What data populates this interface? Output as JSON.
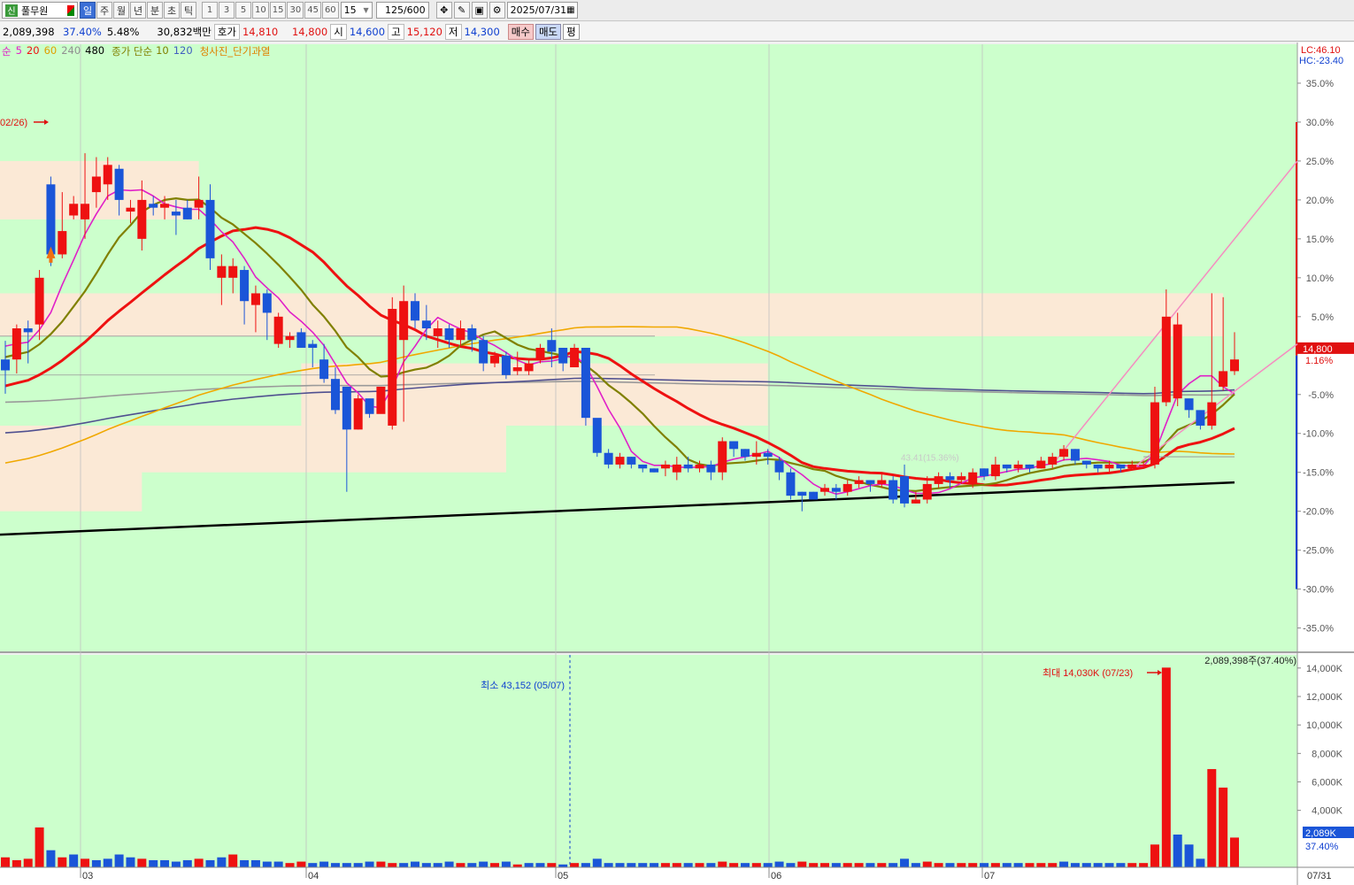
{
  "toolbar": {
    "logo": "신",
    "stock_name": "풀무원",
    "periods": [
      "일",
      "주",
      "월",
      "년",
      "분",
      "초",
      "틱"
    ],
    "selected_period": "일",
    "intervals": [
      "1",
      "3",
      "5",
      "10",
      "15",
      "30",
      "45",
      "60"
    ],
    "interval_select": "15",
    "count": "125",
    "count_total": "/600",
    "date": "2025/07/31"
  },
  "quote": {
    "volume": "2,089,398",
    "volume_ratio": "37.40%",
    "turnover": "5.48%",
    "amount": "30,832백만",
    "ask_label": "호가",
    "ask1": "14,810",
    "ask2": "14,800",
    "open_label": "시",
    "open": "14,600",
    "high_label": "고",
    "high": "15,120",
    "low_label": "저",
    "low": "14,300",
    "buy_label": "매수",
    "sell_label": "매도",
    "avg_label": "평"
  },
  "legend": {
    "ma_label": "순",
    "ma_periods": [
      "5",
      "20",
      "60",
      "240",
      "480"
    ],
    "vol_ma_label": "종가 단순",
    "vol_ma_periods": [
      "10",
      "120"
    ],
    "signal_label": "청사진_단기과열"
  },
  "colors": {
    "background": "#ccffcc",
    "up": "#ee1111",
    "down": "#1a55d8",
    "ma5": "#e020c8",
    "ma20": "#808000",
    "ma60": "#ee1111",
    "ma240": "#f0a800",
    "ma480": "#505090",
    "zone": "#fbe9d6"
  },
  "chart_data": [
    {
      "type": "candlestick",
      "title": "",
      "x_ticks": [
        "03",
        "04",
        "05",
        "06",
        "07",
        "07/31"
      ],
      "y_axis_right": [
        "35.0%",
        "30.0%",
        "25.0%",
        "20.0%",
        "15.0%",
        "10.0%",
        "5.0%",
        "-5.0%",
        "-10.0%",
        "-15.0%",
        "-20.0%",
        "-25.0%",
        "-30.0%",
        "-35.0%"
      ],
      "ylim": [
        -38,
        40
      ],
      "reference_labels": {
        "lc": "LC:46.10",
        "hc": "HC:-23.40"
      },
      "current_price_label": "14,800",
      "current_change_label": "1.16%",
      "annotations": [
        "02/26)",
        "43.41(15.36%)"
      ],
      "candles": [
        [
          -0.5,
          -1.9,
          1.9,
          -4.9
        ],
        [
          -0.5,
          3.5,
          4.0,
          -2.3
        ],
        [
          3.5,
          3.0,
          4.5,
          -1.0
        ],
        [
          4.0,
          10.0,
          11.0,
          2.0
        ],
        [
          22.0,
          13.0,
          23.0,
          11.5
        ],
        [
          13.0,
          16.0,
          21.0,
          12.5
        ],
        [
          18.0,
          19.5,
          20.5,
          17.5
        ],
        [
          17.5,
          19.5,
          26.0,
          15.0
        ],
        [
          21.0,
          23.0,
          25.5,
          19.0
        ],
        [
          22.0,
          24.5,
          25.5,
          20.0
        ],
        [
          24.0,
          20.0,
          24.5,
          18.0
        ],
        [
          18.5,
          19.0,
          20.0,
          17.0
        ],
        [
          15.0,
          20.0,
          22.5,
          13.5
        ],
        [
          19.5,
          19.0,
          20.5,
          18.0
        ],
        [
          19.0,
          19.5,
          20.5,
          17.5
        ],
        [
          18.5,
          18.0,
          20.0,
          15.5
        ],
        [
          19.0,
          17.5,
          20.0,
          17.5
        ],
        [
          19.0,
          20.0,
          23.0,
          17.5
        ],
        [
          20.0,
          12.5,
          22.0,
          11.0
        ],
        [
          10.0,
          11.5,
          13.0,
          6.5
        ],
        [
          10.0,
          11.5,
          12.5,
          8.0
        ],
        [
          11.0,
          7.0,
          11.5,
          4.0
        ],
        [
          6.5,
          8.0,
          9.0,
          3.0
        ],
        [
          8.0,
          5.5,
          8.5,
          2.0
        ],
        [
          1.5,
          5.0,
          5.5,
          1.0
        ],
        [
          2.0,
          2.5,
          3.0,
          1.0
        ],
        [
          3.0,
          1.0,
          3.5,
          1.5
        ],
        [
          1.5,
          1.0,
          2.0,
          -1.5
        ],
        [
          -0.5,
          -3.0,
          1.5,
          -3.5
        ],
        [
          -3.0,
          -7.0,
          -1.5,
          -7.5
        ],
        [
          -4.0,
          -9.5,
          -4.0,
          -17.5
        ],
        [
          -9.5,
          -5.5,
          -5.0,
          -9.5
        ],
        [
          -5.5,
          -7.5,
          -6.0,
          -8.0
        ],
        [
          -7.5,
          -4.0,
          -4.0,
          -6.5
        ],
        [
          -9.0,
          6.0,
          7.5,
          -9.5
        ],
        [
          2.0,
          7.0,
          9.0,
          -8.5
        ],
        [
          7.0,
          4.5,
          8.0,
          3.5
        ],
        [
          4.5,
          3.5,
          6.5,
          2.0
        ],
        [
          2.5,
          3.5,
          4.5,
          1.0
        ],
        [
          3.5,
          2.0,
          4.0,
          1.0
        ],
        [
          2.0,
          3.5,
          4.5,
          1.0
        ],
        [
          3.5,
          2.0,
          4.0,
          0.5
        ],
        [
          2.0,
          -1.0,
          2.5,
          -2.0
        ],
        [
          -1.0,
          0.0,
          0.5,
          -1.5
        ],
        [
          0.0,
          -2.5,
          0.5,
          -3.0
        ],
        [
          -2.0,
          -1.5,
          0.5,
          -2.5
        ],
        [
          -2.0,
          -1.0,
          -0.5,
          -2.5
        ],
        [
          -0.5,
          1.0,
          1.5,
          -1.0
        ],
        [
          2.0,
          0.5,
          3.5,
          -1.5
        ],
        [
          1.0,
          -1.0,
          0.5,
          -2.0
        ],
        [
          -1.5,
          1.0,
          1.5,
          -1.5
        ],
        [
          1.0,
          -8.0,
          -1.0,
          -9.0
        ],
        [
          -8.0,
          -12.5,
          -8.5,
          -13.0
        ],
        [
          -12.5,
          -14.0,
          -12.0,
          -14.5
        ],
        [
          -14.0,
          -13.0,
          -12.5,
          -14.5
        ],
        [
          -13.0,
          -14.0,
          -13.0,
          -14.5
        ],
        [
          -14.0,
          -14.5,
          -14.0,
          -15.0
        ],
        [
          -14.5,
          -15.0,
          -14.5,
          -15.0
        ],
        [
          -14.5,
          -14.0,
          -13.5,
          -15.5
        ],
        [
          -15.0,
          -14.0,
          -13.0,
          -16.0
        ],
        [
          -14.0,
          -14.5,
          -13.0,
          -15.0
        ],
        [
          -14.5,
          -14.0,
          -13.5,
          -15.0
        ],
        [
          -14.0,
          -15.0,
          -13.5,
          -16.0
        ],
        [
          -15.0,
          -11.0,
          -10.5,
          -16.0
        ],
        [
          -11.0,
          -12.0,
          -11.0,
          -13.0
        ],
        [
          -12.0,
          -13.0,
          -12.0,
          -13.5
        ],
        [
          -13.0,
          -12.5,
          -11.0,
          -14.0
        ],
        [
          -12.5,
          -13.0,
          -12.0,
          -14.0
        ],
        [
          -13.5,
          -15.0,
          -13.0,
          -16.0
        ],
        [
          -15.0,
          -18.0,
          -14.5,
          -18.5
        ],
        [
          -17.5,
          -18.0,
          -17.5,
          -20.0
        ],
        [
          -17.5,
          -18.5,
          -17.5,
          -18.0
        ],
        [
          -17.5,
          -17.0,
          -16.5,
          -18.0
        ],
        [
          -17.0,
          -17.5,
          -16.5,
          -18.5
        ],
        [
          -17.5,
          -16.5,
          -16.0,
          -18.0
        ],
        [
          -16.5,
          -16.0,
          -15.5,
          -17.0
        ],
        [
          -16.0,
          -16.5,
          -16.0,
          -17.5
        ],
        [
          -16.5,
          -16.0,
          -15.0,
          -17.0
        ],
        [
          -16.0,
          -18.5,
          -15.5,
          -19.0
        ],
        [
          -15.5,
          -19.0,
          -14.0,
          -19.5
        ],
        [
          -19.0,
          -18.5,
          -17.5,
          -19.0
        ],
        [
          -18.5,
          -16.5,
          -15.5,
          -19.0
        ],
        [
          -16.5,
          -15.5,
          -15.0,
          -17.0
        ],
        [
          -15.5,
          -16.0,
          -15.0,
          -17.0
        ],
        [
          -16.0,
          -15.5,
          -15.0,
          -16.5
        ],
        [
          -16.5,
          -15.0,
          -14.5,
          -17.0
        ],
        [
          -14.5,
          -15.5,
          -14.5,
          -16.0
        ],
        [
          -15.5,
          -14.0,
          -13.0,
          -16.0
        ],
        [
          -14.0,
          -14.5,
          -14.0,
          -15.0
        ],
        [
          -14.5,
          -14.0,
          -13.5,
          -15.0
        ],
        [
          -14.0,
          -14.5,
          -14.0,
          -15.0
        ],
        [
          -14.5,
          -13.5,
          -13.0,
          -14.5
        ],
        [
          -14.0,
          -13.0,
          -12.5,
          -14.5
        ],
        [
          -13.0,
          -12.0,
          -11.5,
          -13.5
        ],
        [
          -12.0,
          -13.5,
          -12.0,
          -14.0
        ],
        [
          -13.5,
          -14.0,
          -13.5,
          -14.5
        ],
        [
          -14.0,
          -14.5,
          -14.0,
          -15.0
        ],
        [
          -14.5,
          -14.0,
          -13.5,
          -15.0
        ],
        [
          -14.0,
          -14.5,
          -14.0,
          -15.0
        ],
        [
          -14.5,
          -14.0,
          -13.5,
          -14.5
        ],
        [
          -14.0,
          -14.0,
          -13.5,
          -14.5
        ],
        [
          -14.0,
          -6.0,
          -4.0,
          -14.5
        ],
        [
          -6.0,
          5.0,
          8.5,
          -6.5
        ],
        [
          -5.5,
          4.0,
          5.5,
          -6.5
        ],
        [
          -5.5,
          -7.0,
          -6.0,
          -8.0
        ],
        [
          -7.0,
          -9.0,
          -7.5,
          -9.5
        ],
        [
          -9.0,
          -6.0,
          8.0,
          -9.5
        ],
        [
          -4.0,
          -2.0,
          7.5,
          -4.5
        ],
        [
          -2.0,
          -0.5,
          3.0,
          -2.5
        ]
      ],
      "candle_x_ticks_at": {
        "03": 91,
        "04": 346,
        "05": 628,
        "06": 869,
        "07": 1110
      }
    },
    {
      "type": "bar",
      "title": "",
      "y_ticks": [
        "14,000K",
        "12,000K",
        "10,000K",
        "8,000K",
        "6,000K",
        "4,000K"
      ],
      "ylim": [
        0,
        14300
      ],
      "annotations": [
        "2,089,398주(37.40%)",
        "최대 14,030K (07/23)",
        "최소 43,152 (05/07)",
        "2,089K",
        "37.40%"
      ],
      "values": [
        700,
        500,
        600,
        2800,
        1200,
        700,
        900,
        600,
        500,
        600,
        900,
        700,
        600,
        500,
        500,
        400,
        500,
        600,
        500,
        700,
        900,
        500,
        500,
        400,
        400,
        300,
        400,
        300,
        400,
        300,
        300,
        300,
        400,
        400,
        300,
        300,
        400,
        300,
        300,
        400,
        300,
        300,
        400,
        300,
        400,
        200,
        300,
        300,
        300,
        200,
        300,
        300,
        600,
        300,
        300,
        300,
        300,
        300,
        300,
        300,
        300,
        300,
        300,
        400,
        300,
        300,
        300,
        300,
        400,
        300,
        400,
        300,
        300,
        300,
        300,
        300,
        300,
        300,
        300,
        600,
        300,
        400,
        300,
        300,
        300,
        300,
        300,
        300,
        300,
        300,
        300,
        300,
        300,
        400,
        300,
        300,
        300,
        300,
        300,
        300,
        300,
        1600,
        14030,
        2300,
        1600,
        600,
        6900,
        5600,
        2089
      ],
      "up_flags": [
        1,
        1,
        1,
        1,
        0,
        1,
        0,
        1,
        0,
        0,
        0,
        0,
        1,
        0,
        0,
        0,
        0,
        1,
        0,
        0,
        1,
        0,
        0,
        0,
        0,
        1,
        1,
        0,
        0,
        0,
        0,
        0,
        0,
        1,
        1,
        0,
        0,
        0,
        0,
        0,
        1,
        0,
        0,
        1,
        0,
        1,
        0,
        0,
        1,
        0,
        1,
        0,
        0,
        0,
        0,
        0,
        0,
        0,
        1,
        1,
        0,
        1,
        0,
        1,
        1,
        0,
        1,
        0,
        0,
        0,
        1,
        1,
        1,
        0,
        1,
        1,
        0,
        1,
        0,
        0,
        0,
        1,
        1,
        0,
        1,
        1,
        0,
        1,
        0,
        0,
        1,
        1,
        1,
        0,
        0,
        0,
        0,
        0,
        0,
        1,
        1,
        1,
        1,
        0,
        0,
        0,
        1,
        1,
        1
      ]
    }
  ]
}
